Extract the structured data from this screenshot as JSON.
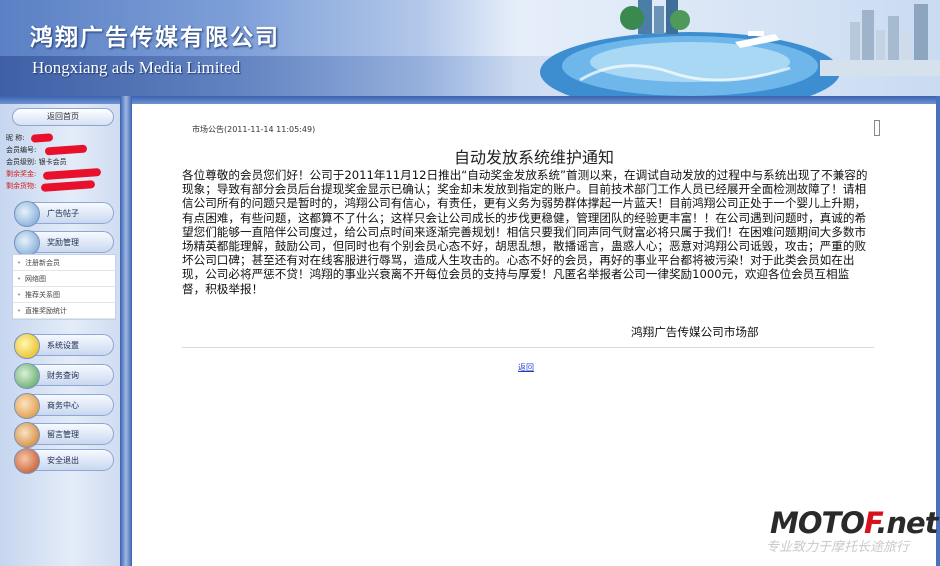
{
  "header": {
    "title_cn": "鸿翔广告传媒有限公司",
    "title_en": "Hongxiang ads Media Limited"
  },
  "sidebar": {
    "home_button": "返回首页",
    "user_info": [
      {
        "label": "昵 称:",
        "value": ""
      },
      {
        "label": "会员编号:",
        "value": ""
      },
      {
        "label": "会员级别: ",
        "value": "银卡会员"
      },
      {
        "label": "剩余奖金:",
        "value": ""
      },
      {
        "label": "剩余货物:",
        "value": ""
      }
    ],
    "menu": [
      {
        "label": "广告帖子",
        "icon": "news-icon"
      },
      {
        "label": "奖励管理",
        "icon": "award-icon"
      },
      {
        "label": "系统设置",
        "icon": "settings-icon"
      },
      {
        "label": "财务查询",
        "icon": "finance-icon"
      },
      {
        "label": "商务中心",
        "icon": "users-icon"
      },
      {
        "label": "留言管理",
        "icon": "message-icon"
      },
      {
        "label": "安全退出",
        "icon": "logout-icon"
      }
    ],
    "submenu": [
      "注册新会员",
      "网络图",
      "推荐关系图",
      "直推奖励统计"
    ]
  },
  "notice": {
    "meta": "市场公告(2011-11-14 11:05:49)",
    "title": "自动发放系统维护通知",
    "body": "各位尊敬的会员您们好！公司于2011年11月12日推出“自动奖金发放系统”首测以来，在调试自动发放的过程中与系统出现了不兼容的现象；导致有部分会员后台提现奖金显示已确认；奖金却未发放到指定的账户。目前技术部门工作人员已经展开全面检测故障了！请相信公司所有的问题只是暂时的，鸿翔公司有信心，有责任，更有义务为弱势群体撑起一片蓝天！目前鸿翔公司正处于一个婴儿上升期，有点困难，有些问题，这都算不了什么；这样只会让公司成长的步伐更稳健，管理团队的经验更丰富！！在公司遇到问题时，真诚的希望您们能够一直陪伴公司度过，给公司点时间来逐渐完善规划！相信只要我们同声同气财富必将只属于我们！在困难问题期间大多数市场精英都能理解，鼓励公司，但同时也有个别会员心态不好，胡思乱想，散播谣言，蛊惑人心；恶意对鸿翔公司诋毁，攻击；严重的败坏公司口碑；甚至还有对在线客服进行辱骂，造成人生攻击的。心态不好的会员，再好的事业平台都将被污染！对于此类会员如在出现，公司必将严惩不贷！鸿翔的事业兴衰离不开每位会员的支持与厚爱！凡匿名举报者公司一律奖励1000元，欢迎各位会员互相监督，积极举报！",
    "signature": "鸿翔广告传媒公司市场部",
    "back_link": "返回"
  },
  "watermark": {
    "logo_part1": "MOTO",
    "logo_part2": "F",
    "logo_part3": ".net",
    "tagline": "专业致力于摩托长途旅行",
    "colors": {
      "dark": "#2a2a2a",
      "red": "#d8121a",
      "light": "#c9c9c9"
    }
  },
  "colors": {
    "frame_blue": "#3a62b0",
    "link": "#1f3fc8",
    "alert_red": "#d21c1c"
  }
}
